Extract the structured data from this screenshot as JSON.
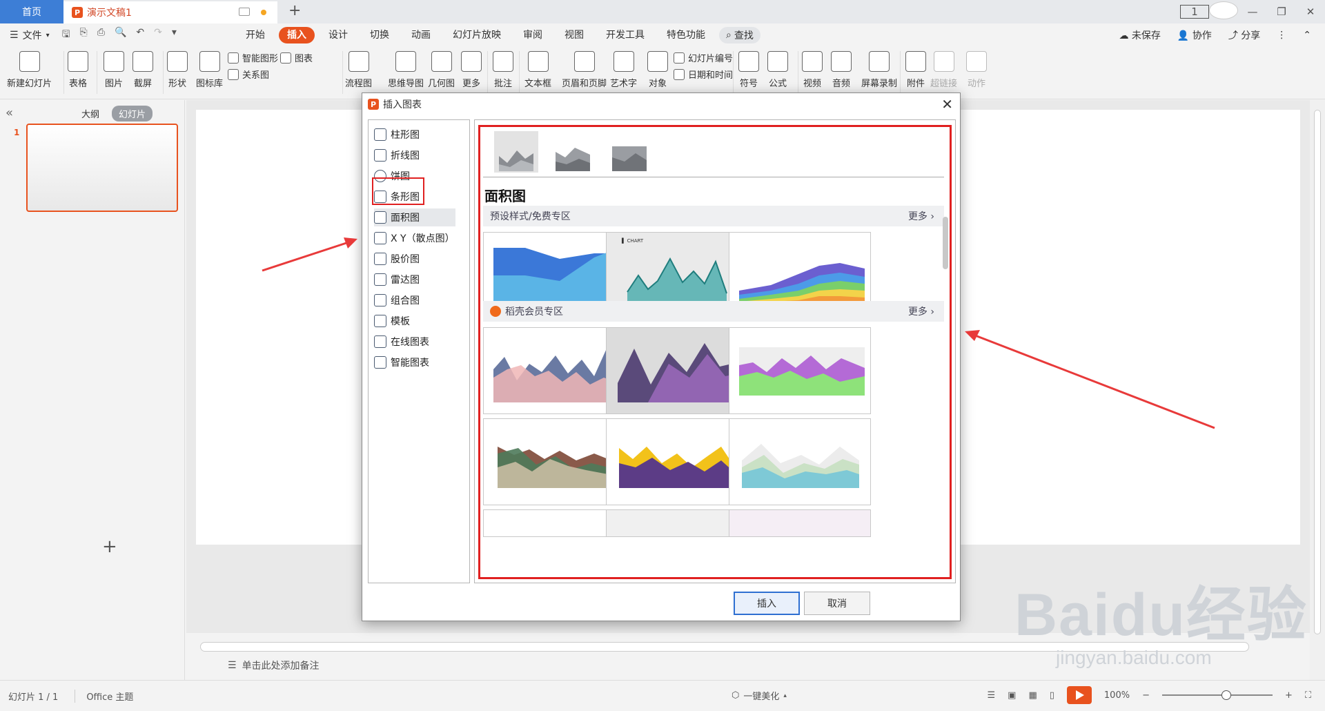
{
  "titlebar": {
    "home_tab": "首页",
    "doc_tab": "演示文稿1",
    "doc_icon": "P",
    "new_tab": "+",
    "page_indicator": "1"
  },
  "menubar": {
    "file": "文件",
    "tabs": [
      "开始",
      "插入",
      "设计",
      "切换",
      "动画",
      "幻灯片放映",
      "审阅",
      "视图",
      "开发工具",
      "特色功能"
    ],
    "active_tab": "插入",
    "search": "查找",
    "unsaved": "未保存",
    "collab": "协作",
    "share": "分享"
  },
  "ribbon": {
    "new_slide": "新建幻灯片",
    "table": "表格",
    "picture": "图片",
    "screenshot": "截屏",
    "shape": "形状",
    "icon_lib": "图标库",
    "smart_shape": "智能图形",
    "chart": "图表",
    "relation": "关系图",
    "online_chart": "在线图表",
    "flowchart": "流程图",
    "mindmap": "思维导图",
    "geometry": "几何图",
    "more": "更多",
    "comment": "批注",
    "textbox": "文本框",
    "header_footer": "页眉和页脚",
    "art_text": "艺术字",
    "object": "对象",
    "slide_number": "幻灯片编号",
    "date_time": "日期和时间",
    "symbol": "符号",
    "formula": "公式",
    "video": "视频",
    "audio": "音频",
    "screen_record": "屏幕录制",
    "attachment": "附件",
    "hyperlink": "超链接",
    "action": "动作"
  },
  "leftpane": {
    "outline_tab": "大纲",
    "slides_tab": "幻灯片",
    "slide_number": "1",
    "add": "+"
  },
  "notes": {
    "placeholder": "单击此处添加备注"
  },
  "statusbar": {
    "slide_info": "幻灯片 1 / 1",
    "theme": "Office 主题",
    "beautify": "一键美化",
    "zoom": "100%",
    "zoom_level": 0.5
  },
  "dialog": {
    "title": "插入图表",
    "chart_types": [
      "柱形图",
      "折线图",
      "饼图",
      "条形图",
      "面积图",
      "X Y（散点图）",
      "股价图",
      "雷达图",
      "组合图",
      "模板",
      "在线图表",
      "智能图表"
    ],
    "selected_type": "面积图",
    "section_title": "面积图",
    "preset_band": "预设样式/免费专区",
    "member_band": "稻壳会员专区",
    "more": "更多",
    "insert_button": "插入",
    "cancel_button": "取消",
    "cards_preset": [
      {
        "title": "",
        "colors": [
          "#3b78d8",
          "#5ab4e6"
        ]
      },
      {
        "title": "CHART",
        "colors": [
          "#3aa6a6",
          "#2b8f8f"
        ]
      },
      {
        "title": "",
        "colors": [
          "#6b5fd0",
          "#4c9be8",
          "#7acf6a",
          "#f3d34a",
          "#f39a3a",
          "#ee5a3a"
        ]
      }
    ],
    "cards_member": [
      {
        "title": "",
        "colors": [
          "#6a7aa3",
          "#f0b6b6"
        ]
      },
      {
        "title": "",
        "colors": [
          "#5a4a7a",
          "#a06cc0"
        ]
      },
      {
        "title": "",
        "colors": [
          "#b46ad6",
          "#8ee27a"
        ]
      },
      {
        "title": "",
        "colors": [
          "#8a5a4a",
          "#4e7a5a",
          "#e9d2b8"
        ]
      },
      {
        "title": "",
        "colors": [
          "#5c3c86",
          "#f2c21a"
        ]
      },
      {
        "title": "",
        "colors": [
          "#7ec9d6",
          "#c7e0c1",
          "#ececec"
        ]
      }
    ]
  },
  "watermark": {
    "brand": "Baidu经验",
    "url": "jingyan.baidu.com"
  },
  "colors": {
    "accent": "#e8521e",
    "home_tab": "#3d7ed6",
    "highlight": "#e02020"
  }
}
